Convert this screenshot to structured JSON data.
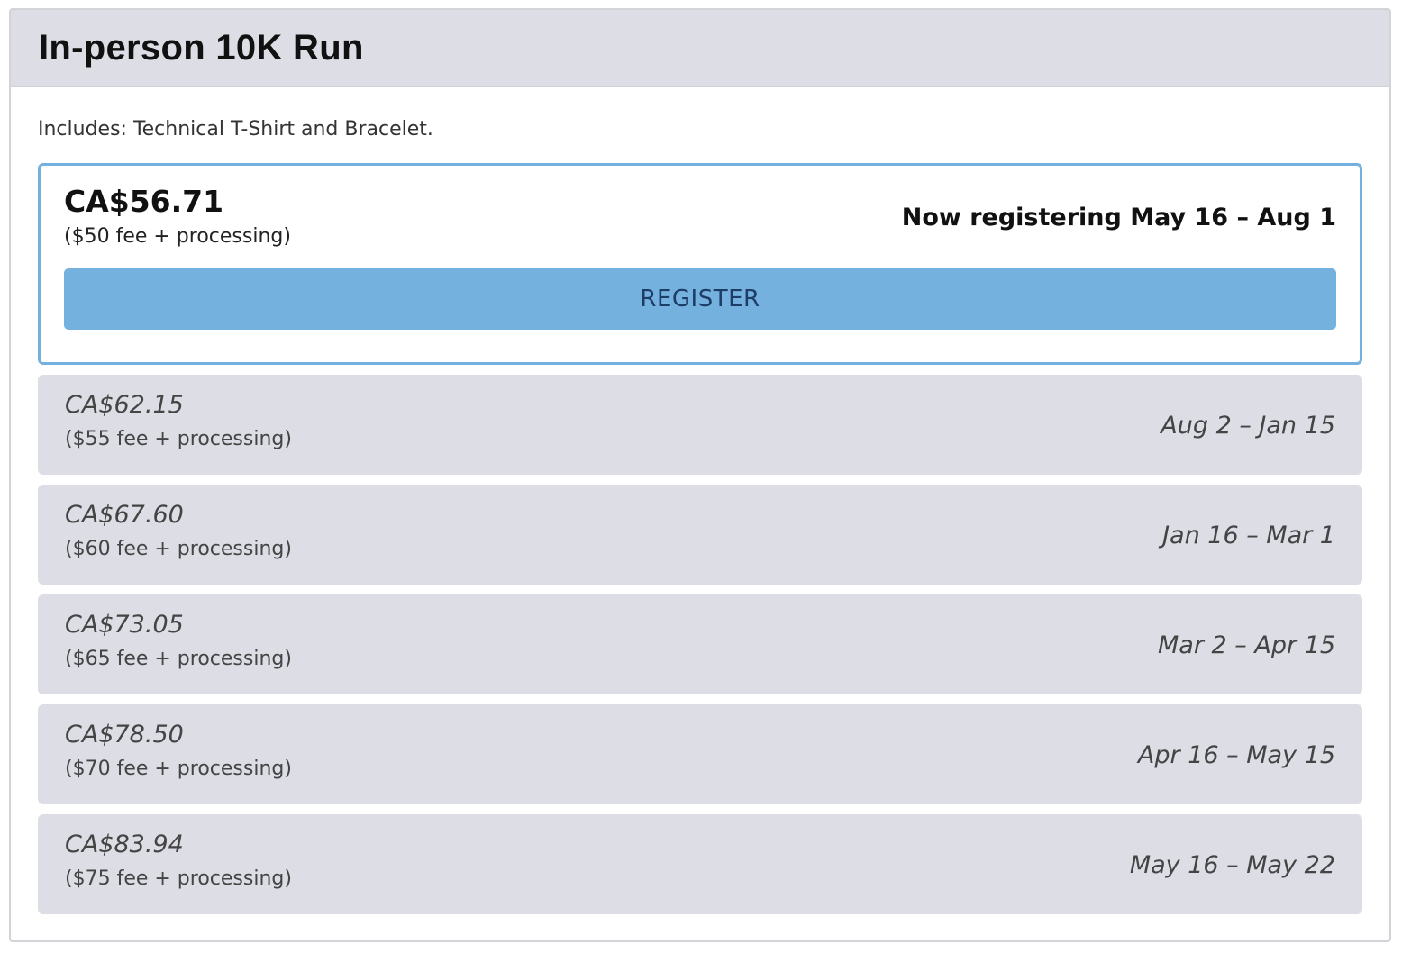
{
  "event": {
    "title": "In-person 10K Run",
    "includes": "Includes: Technical T-Shirt and Bracelet."
  },
  "current_tier": {
    "price": "CA$56.71",
    "fee": "($50 fee + processing)",
    "window": "Now registering May 16 – Aug 1",
    "register_label": "REGISTER"
  },
  "tiers": [
    {
      "price": "CA$62.15",
      "fee": "($55 fee + processing)",
      "window": "Aug 2 – Jan 15"
    },
    {
      "price": "CA$67.60",
      "fee": "($60 fee + processing)",
      "window": "Jan 16 – Mar 1"
    },
    {
      "price": "CA$73.05",
      "fee": "($65 fee + processing)",
      "window": "Mar 2 – Apr 15"
    },
    {
      "price": "CA$78.50",
      "fee": "($70 fee + processing)",
      "window": "Apr 16 – May 15"
    },
    {
      "price": "CA$83.94",
      "fee": "($75 fee + processing)",
      "window": "May 16 – May 22"
    }
  ],
  "colors": {
    "accent": "#75b1df",
    "header_bg": "#dcdde5",
    "button_text": "#1d3d66"
  }
}
